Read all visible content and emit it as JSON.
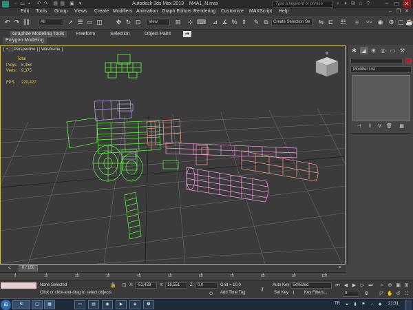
{
  "app": {
    "title": "Autodesk 3ds Max 2013",
    "file": "M4A1_N.max",
    "search_placeholder": "Type a keyword or phrase"
  },
  "menu": [
    "Edit",
    "Tools",
    "Group",
    "Views",
    "Create",
    "Modifiers",
    "Animation",
    "Graph Editors",
    "Rendering",
    "Customize",
    "MAXScript",
    "Help"
  ],
  "toolbar": {
    "selection_filter": "All",
    "ref_coord": "View",
    "named_selection": "Create Selection Se"
  },
  "ribbon": {
    "tabs": [
      "Graphite Modeling Tools",
      "Freeform",
      "Selection",
      "Object Paint"
    ],
    "subtab": "Polygon Modeling"
  },
  "viewport": {
    "label": "[ + ] [ Perspective ] [ Wireframe ]",
    "stats": {
      "total_label": "Total",
      "polys_label": "Polys:",
      "polys_value": "8,458",
      "verts_label": "Verts:",
      "verts_value": "9,375",
      "fps_label": "FPS:",
      "fps_value": "220,427"
    }
  },
  "command_panel": {
    "modifier_list": "Modifier List"
  },
  "timeline": {
    "frame_display": "0 / 100",
    "ticks": [
      "0",
      "10",
      "20",
      "30",
      "40",
      "50",
      "60",
      "70",
      "80",
      "90",
      "100"
    ]
  },
  "status": {
    "selection": "None Selected",
    "hint": "Click or click-and-drag to select objects",
    "x_label": "X:",
    "x_value": "-51,428",
    "y_label": "Y:",
    "y_value": "16,551",
    "z_label": "Z:",
    "z_value": "0,0",
    "grid": "Grid = 10,0",
    "auto_key": "Auto Key",
    "auto_key_mode": "Selected",
    "set_key": "Set Key",
    "key_filters": "Key Filters...",
    "add_time_tag": "Add Time Tag",
    "time_label": "Time",
    "time_value": "0:00:02",
    "frame": "0"
  },
  "taskbar": {
    "language": "TR",
    "clock": "21:31",
    "tasks": [
      "Sl"
    ]
  },
  "colors": {
    "viewport_border": "#d9c34a",
    "wire_green": "#5cff3a",
    "wire_pink": "#ff9cf0",
    "wire_salmon": "#ff9a8a",
    "wire_violet": "#c79cff",
    "stat_yellow": "#e8c84a"
  }
}
